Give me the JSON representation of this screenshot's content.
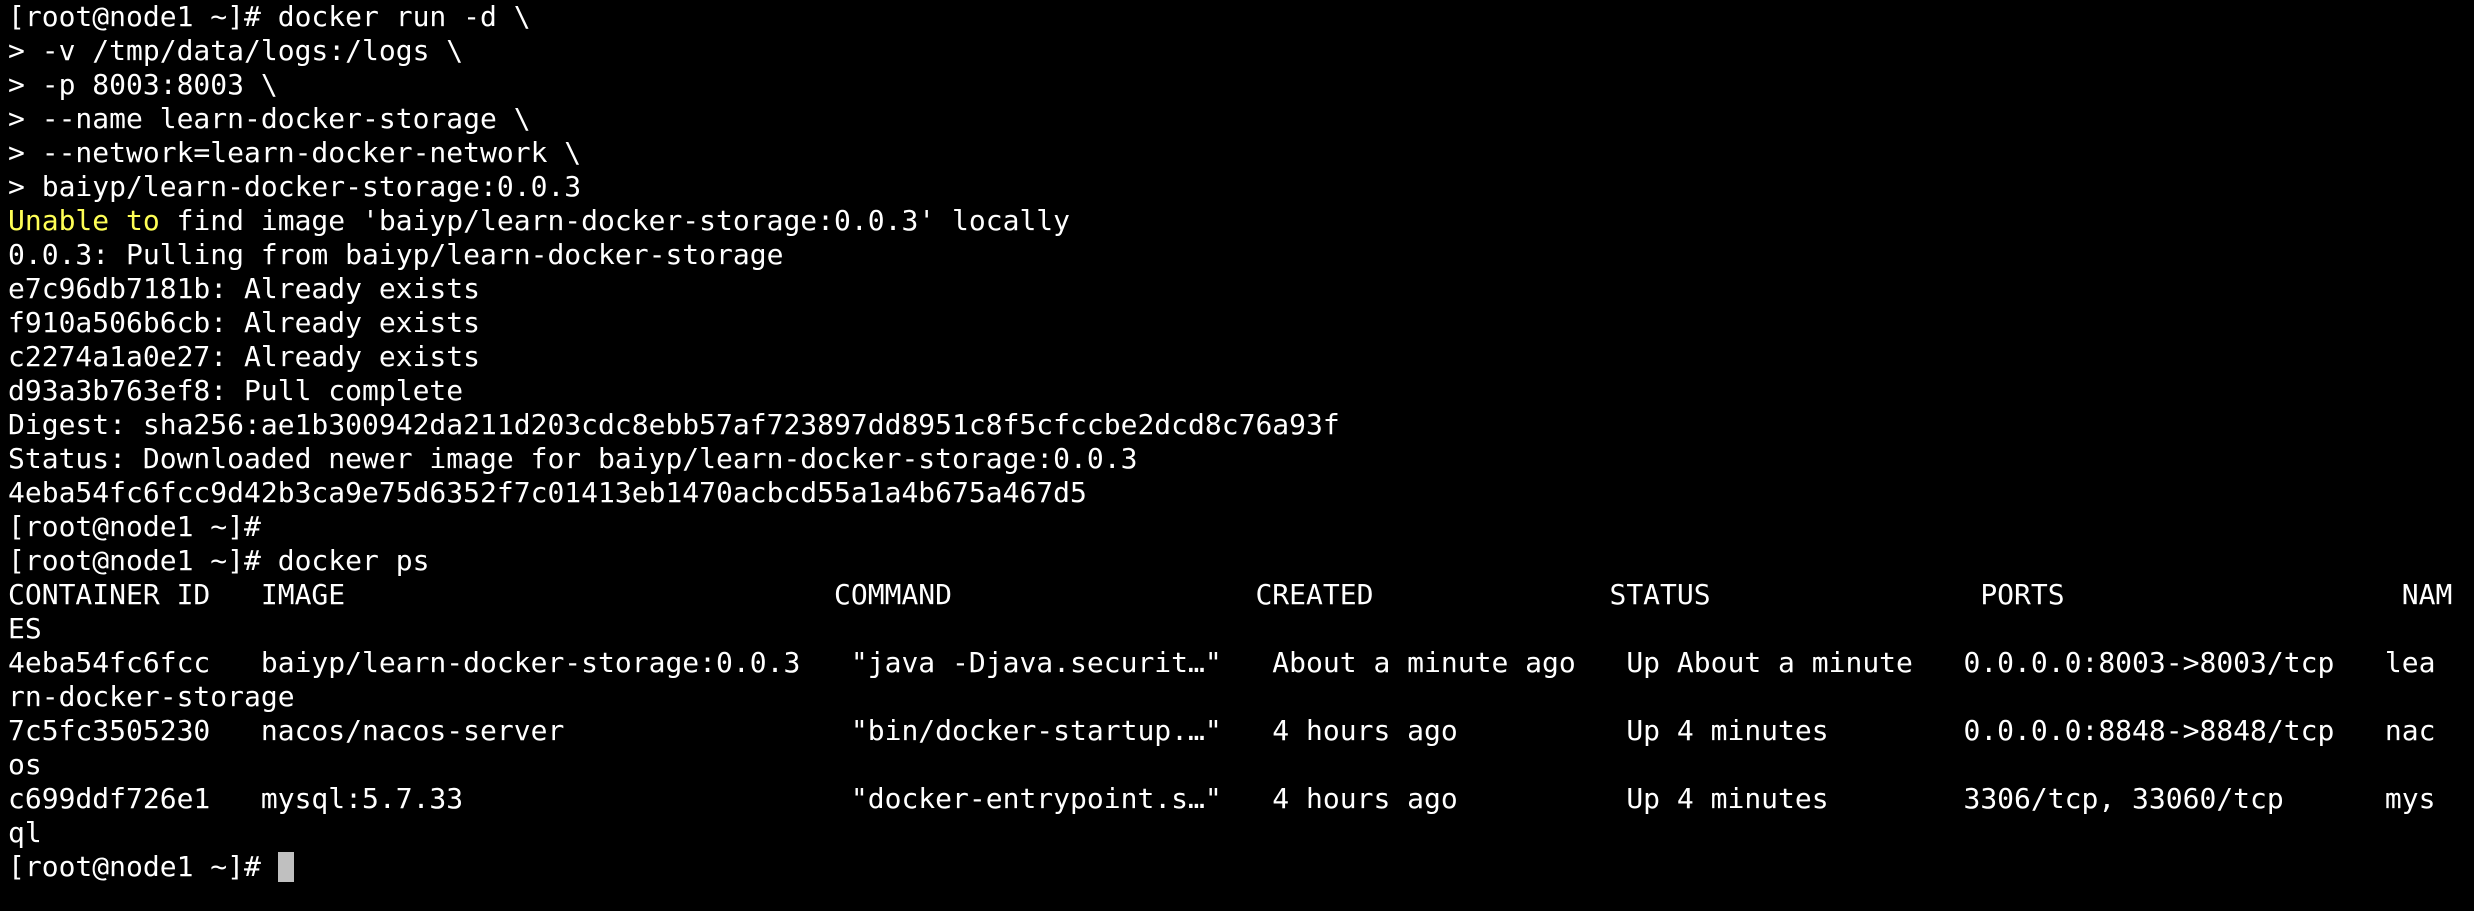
{
  "terminal": {
    "theme": {
      "background": "#000000",
      "foreground": "#ffffff",
      "highlight": "#ffff55",
      "cursor": "#c0c0c0"
    },
    "lines": [
      "[root@node1 ~]# docker run -d \\",
      "> -v /tmp/data/logs:/logs \\",
      "> -p 8003:8003 \\",
      "> --name learn-docker-storage \\",
      "> --network=learn-docker-network \\",
      "> baiyp/learn-docker-storage:0.0.3",
      {
        "highlight": "Unable to",
        "text": " find image 'baiyp/learn-docker-storage:0.0.3' locally"
      },
      "0.0.3: Pulling from baiyp/learn-docker-storage",
      "e7c96db7181b: Already exists",
      "f910a506b6cb: Already exists",
      "c2274a1a0e27: Already exists",
      "d93a3b763ef8: Pull complete",
      "Digest: sha256:ae1b300942da211d203cdc8ebb57af723897dd8951c8f5cfccbe2dcd8c76a93f",
      "Status: Downloaded newer image for baiyp/learn-docker-storage:0.0.3",
      "4eba54fc6fcc9d42b3ca9e75d6352f7c01413eb1470acbcd55a1a4b675a467d5",
      "[root@node1 ~]#",
      "[root@node1 ~]# docker ps",
      "CONTAINER ID   IMAGE                             COMMAND                  CREATED              STATUS                PORTS                    NAM",
      "ES",
      "4eba54fc6fcc   baiyp/learn-docker-storage:0.0.3   \"java -Djava.securit…\"   About a minute ago   Up About a minute   0.0.0.0:8003->8003/tcp   lea",
      "rn-docker-storage",
      "7c5fc3505230   nacos/nacos-server                 \"bin/docker-startup.…\"   4 hours ago          Up 4 minutes        0.0.0.0:8848->8848/tcp   nac",
      "os",
      "c699ddf726e1   mysql:5.7.33                       \"docker-entrypoint.s…\"   4 hours ago          Up 4 minutes        3306/tcp, 33060/tcp      mys",
      "ql"
    ],
    "prompt": "[root@node1 ~]# "
  }
}
